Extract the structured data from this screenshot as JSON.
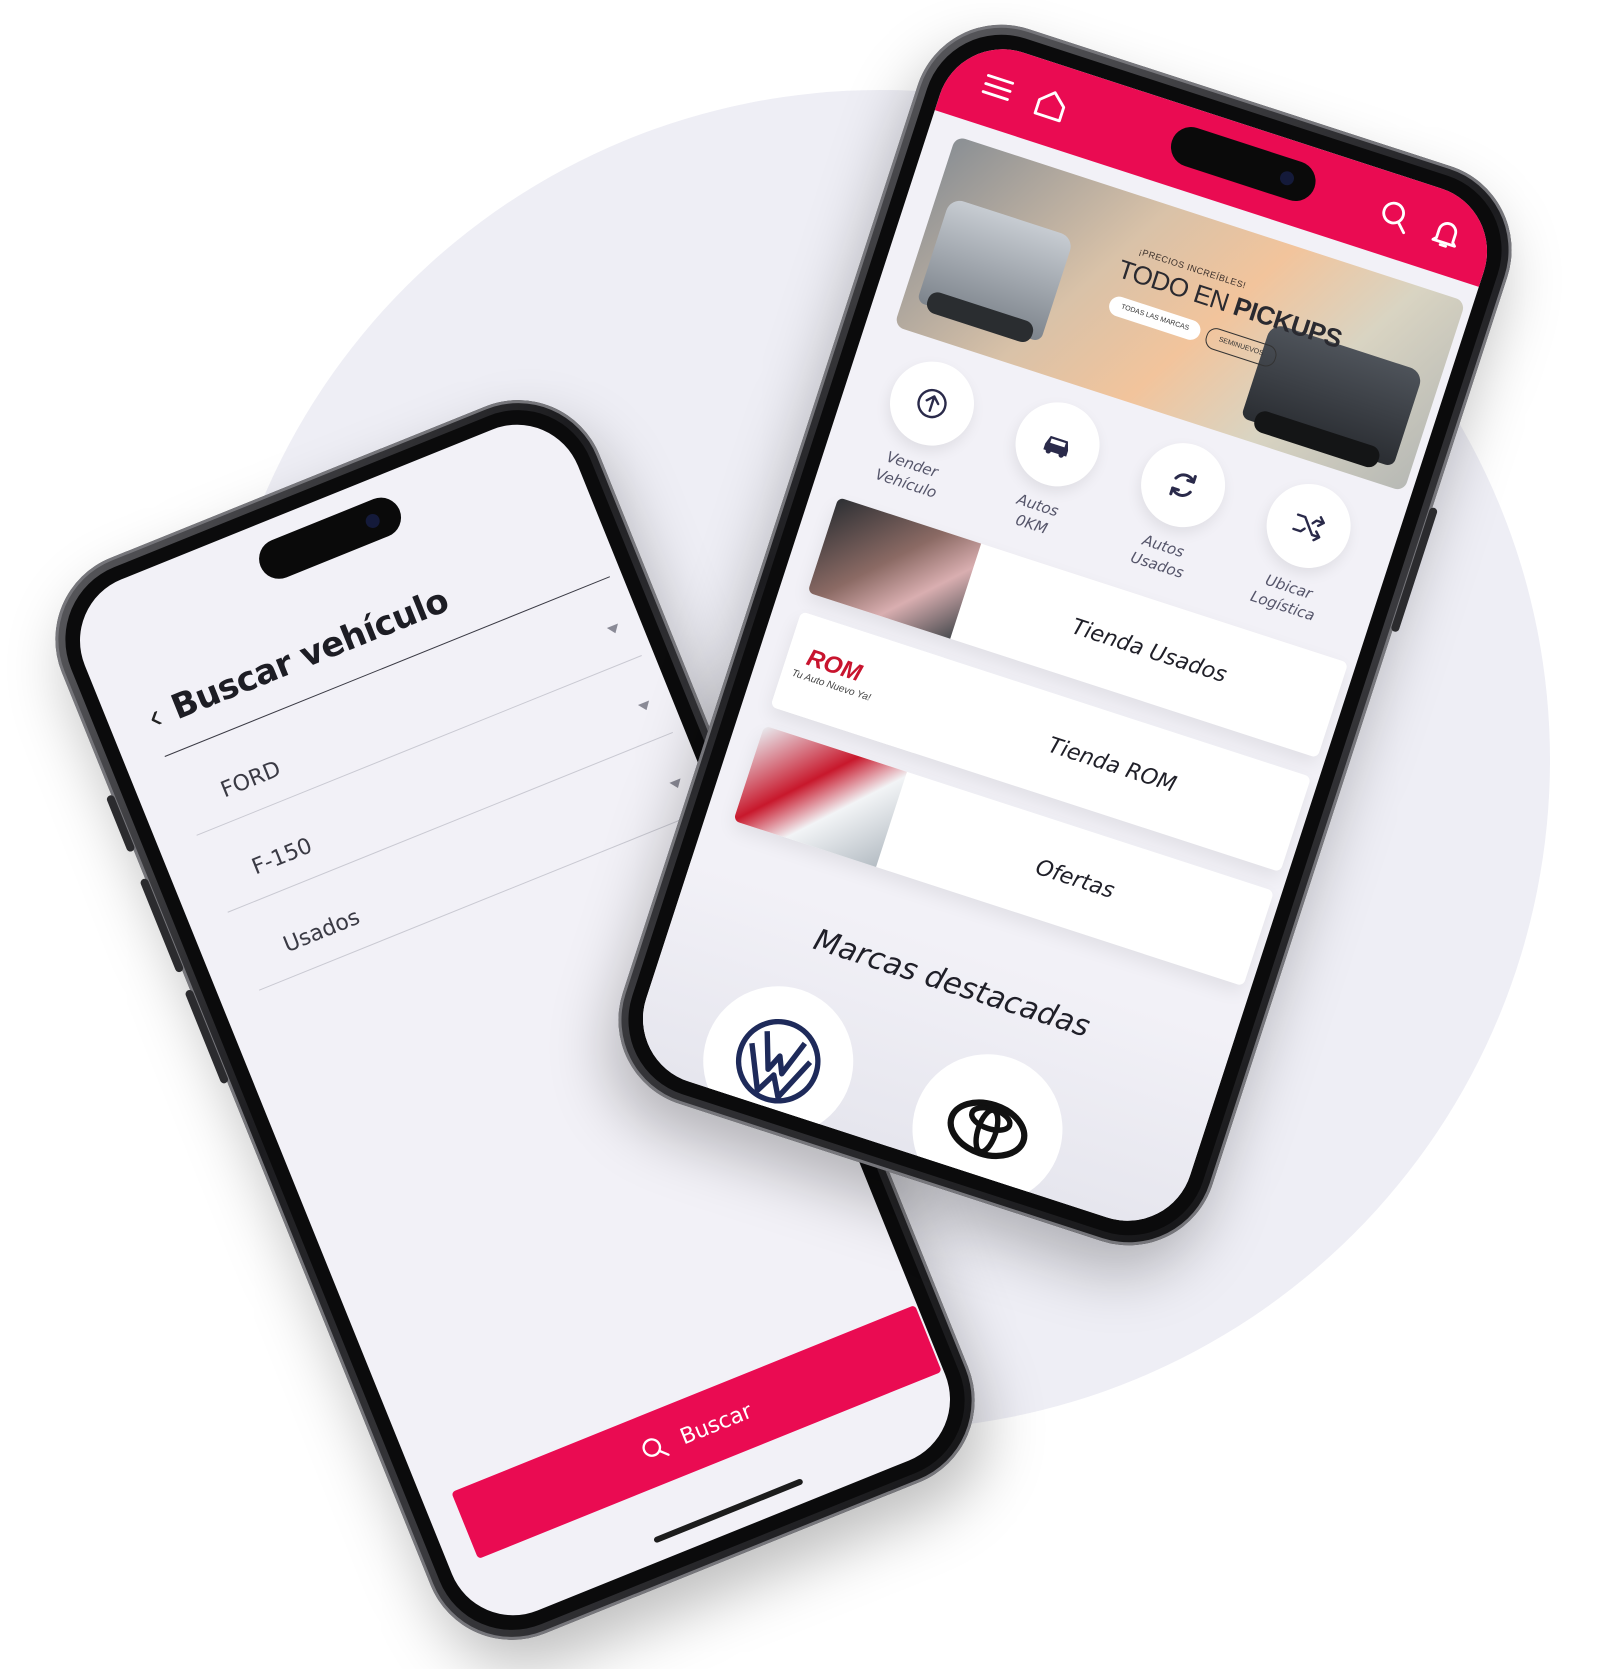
{
  "colors": {
    "accent": "#ea0b52",
    "background_circle": "#eeeef5",
    "screen_bg": "#f2f1f7"
  },
  "search_screen": {
    "back_icon": "chevron-left-icon",
    "title": "Buscar vehículo",
    "fields": [
      {
        "value": "FORD"
      },
      {
        "value": "F-150"
      },
      {
        "value": "Usados"
      }
    ],
    "search_button": {
      "icon": "search-icon",
      "label": "Buscar"
    }
  },
  "home_screen": {
    "topbar": {
      "icons": [
        "menu-icon",
        "home-icon",
        "search-icon",
        "bell-icon"
      ]
    },
    "banner": {
      "kicker": "¡PRECIOS INCREÍBLES!",
      "title_regular": "TODO EN ",
      "title_bold": "PICKUPS",
      "pills": [
        "TODAS LAS MARCAS",
        "SEMINUEVOS"
      ]
    },
    "quick_actions": [
      {
        "icon": "upload-arrow-icon",
        "line1": "Vender",
        "line2": "Vehículo"
      },
      {
        "icon": "car-icon",
        "line1": "Autos",
        "line2": "0KM"
      },
      {
        "icon": "refresh-icon",
        "line1": "Autos",
        "line2": "Usados"
      },
      {
        "icon": "shuffle-icon",
        "line1": "Ubicar",
        "line2": "Logística"
      }
    ],
    "stores": [
      {
        "label": "Tienda Usados"
      },
      {
        "label": "Tienda ROM",
        "logo": "ROM",
        "tagline": "Tu Auto Nuevo Ya!"
      },
      {
        "label": "Ofertas"
      }
    ],
    "brands": {
      "title": "Marcas destacadas",
      "items": [
        "volkswagen-logo-icon",
        "toyota-logo-icon"
      ]
    }
  }
}
